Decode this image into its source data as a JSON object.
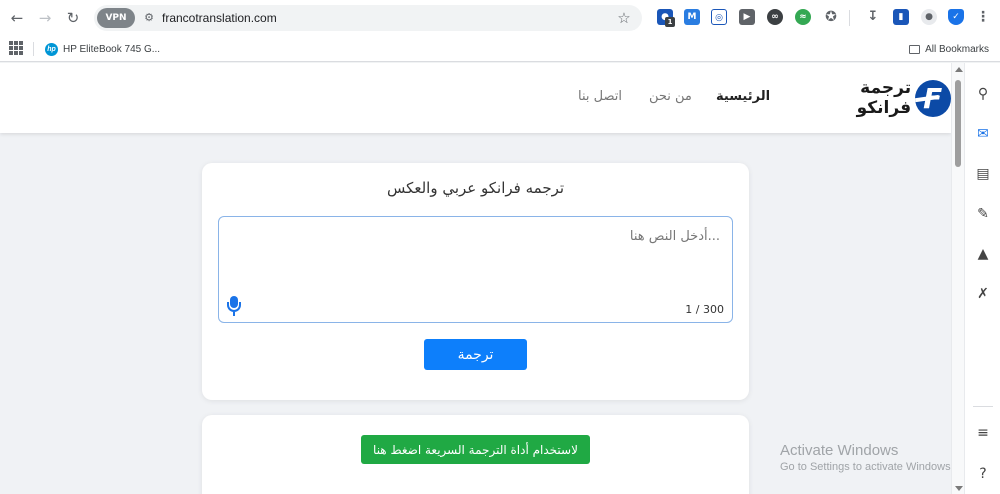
{
  "browser": {
    "url": "francotranslation.com",
    "vpn_label": "VPN",
    "extension_badge": "1",
    "bookmarks": [
      {
        "label": "HP EliteBook 745 G..."
      }
    ],
    "all_bookmarks": "All Bookmarks"
  },
  "site": {
    "logo_text": "ترجمة فرانكو",
    "logo_letter": "F",
    "nav": [
      "الرئيسية",
      "من نحن",
      "اتصل بنا"
    ]
  },
  "translator": {
    "title": "ترجمه فرانكو عربي والعكس",
    "input_value": "",
    "placeholder": "...أدخل النص هنا",
    "counter": "1 / 300",
    "button_label": "ترجمة"
  },
  "quick_tool": {
    "button_label": "لاستخدام أداة الترجمة السريعة اضغط هنا"
  },
  "watermark": {
    "line1": "Activate Windows",
    "line2": "Go to Settings to activate Windows."
  },
  "colors": {
    "brand": "#0c4aa6",
    "primary_button": "#0d7ffb",
    "success_button": "#20a944"
  }
}
